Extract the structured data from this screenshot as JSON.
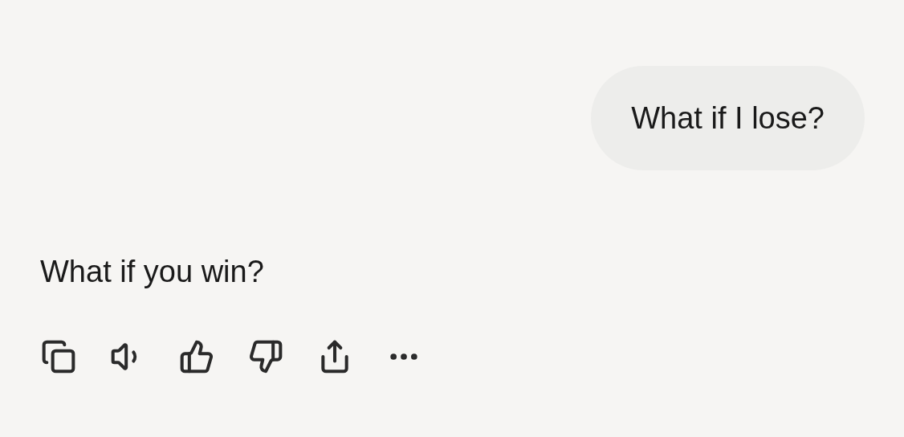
{
  "messages": [
    {
      "kind": "user",
      "text": "What if I lose?"
    },
    {
      "kind": "assistant",
      "text": "What if you win?"
    }
  ]
}
